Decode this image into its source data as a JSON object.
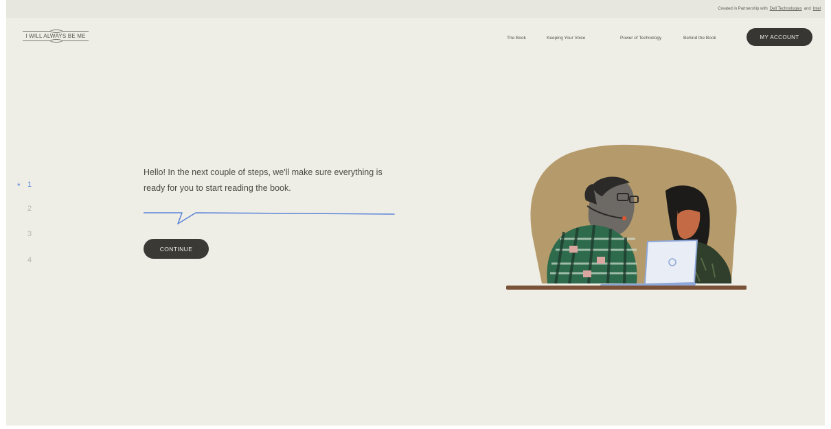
{
  "header": {
    "partner_prefix": "Created in Partnership with",
    "partner_1": "Dell Technologies",
    "partner_joiner": "and",
    "partner_2": "Intel",
    "logo_text": "I WILL ALWAYS BE ME"
  },
  "nav": {
    "items": [
      "The Book",
      "Keeping Your Voice",
      "Power of Technology",
      "Behind the Book"
    ],
    "account_label": "MY ACCOUNT"
  },
  "steps": {
    "active_marker": "*",
    "items": [
      "1",
      "2",
      "3",
      "4"
    ],
    "active_step": "1"
  },
  "intro": {
    "message": "Hello! In the next couple of steps, we'll make sure everything is ready for you to start reading the book.",
    "continue_label": "CONTINUE"
  },
  "icons": {
    "laptop_logo": "dell-logo-icon"
  },
  "colors": {
    "background": "#eeede6",
    "accent_blue": "#5a83d8",
    "button_dark": "#373633",
    "illustration_tan": "#b59b6b"
  }
}
